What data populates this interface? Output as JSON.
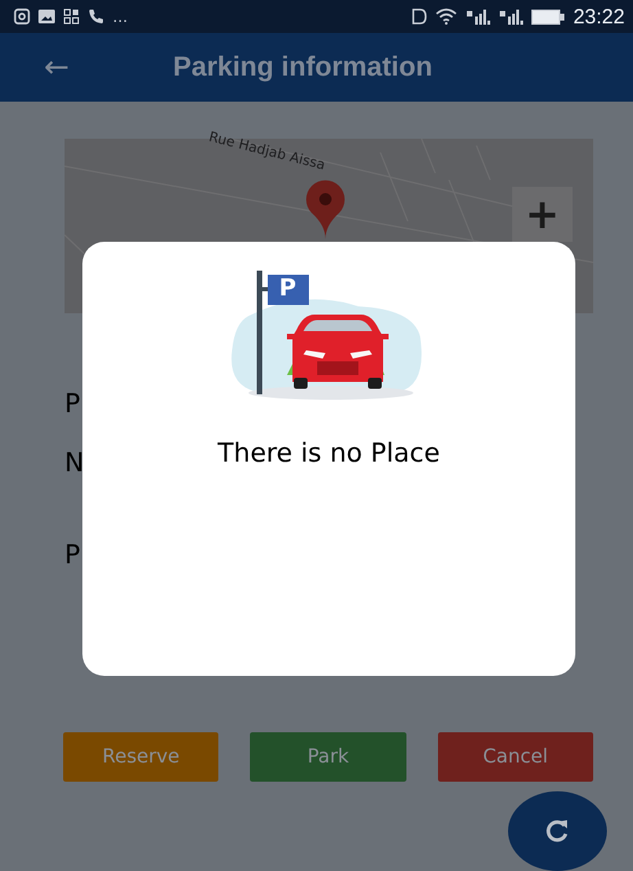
{
  "status_bar": {
    "overflow": "…",
    "time": "23:22"
  },
  "app_bar": {
    "back": "←",
    "title": "Parking information"
  },
  "map": {
    "street": "Rue Hadjab Aissa",
    "zoom": "+"
  },
  "info_labels": [
    "P",
    "N",
    "P"
  ],
  "buttons": [
    {
      "label": "Reserve",
      "color": "#7a4900"
    },
    {
      "label": "Park",
      "color": "#23512a"
    },
    {
      "label": "Cancel",
      "color": "#6f211d"
    }
  ],
  "dialog": {
    "message": "There is no Place",
    "sign": "P"
  }
}
